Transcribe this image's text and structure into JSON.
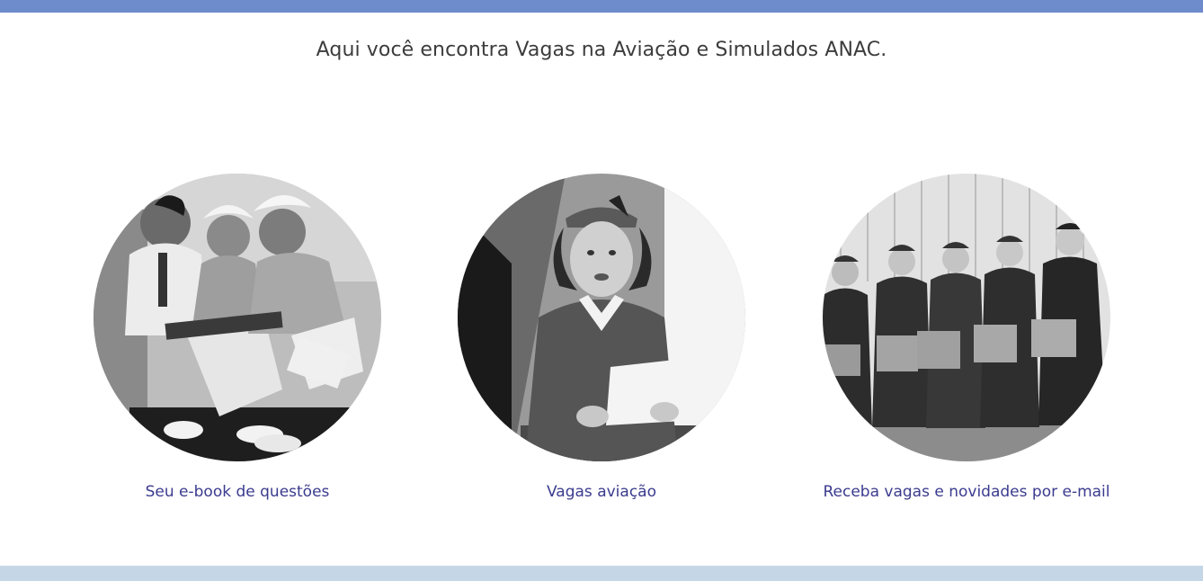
{
  "header": {
    "headline": "Aqui você encontra Vagas na Aviação e Simulados ANAC."
  },
  "cards": [
    {
      "caption": "Seu e-book de questões",
      "image": "vintage-stewardesses-studying-photo"
    },
    {
      "caption": "Vagas aviação",
      "image": "vintage-stewardess-reading-photo"
    },
    {
      "caption": "Receba vagas e novidades por e-mail",
      "image": "vintage-stewardesses-group-photo"
    }
  ],
  "colors": {
    "top_bar": "#6e8ccc",
    "bottom_bar": "#c5d6e6",
    "link": "#3b3b8f",
    "headline": "#3c3c3c"
  }
}
